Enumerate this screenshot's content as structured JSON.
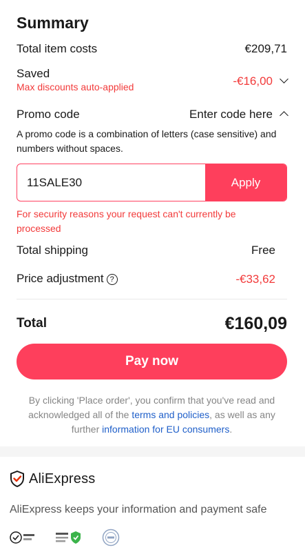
{
  "summary": {
    "title": "Summary",
    "total_item_costs_label": "Total item costs",
    "total_item_costs_value": "€209,71",
    "saved_label": "Saved",
    "saved_sub": "Max discounts auto-applied",
    "saved_value": "-€16,00",
    "promo_label": "Promo code",
    "promo_toggle": "Enter code here",
    "promo_desc": "A promo code is a combination of letters (case sensitive) and numbers without spaces.",
    "promo_input_value": "11SALE30",
    "apply_label": "Apply",
    "error_msg": "For security reasons your request can't currently be processed",
    "shipping_label": "Total shipping",
    "shipping_value": "Free",
    "adjustment_label": "Price adjustment",
    "adjustment_value": "-€33,62",
    "help_glyph": "?",
    "total_label": "Total",
    "total_value": "€160,09",
    "pay_label": "Pay now",
    "disclaimer_pre": "By clicking 'Place order', you confirm that you've read and acknowledged all of the ",
    "terms_link": "terms and policies",
    "disclaimer_mid": ", as well as any further ",
    "eu_link": "information for EU consumers",
    "disclaimer_post": "."
  },
  "footer": {
    "brand": "AliExpress",
    "safe_text": "AliExpress keeps your information and payment safe"
  },
  "colors": {
    "accent": "#fe3f5c",
    "error": "#f23a3a",
    "link": "#1f5fc9"
  }
}
